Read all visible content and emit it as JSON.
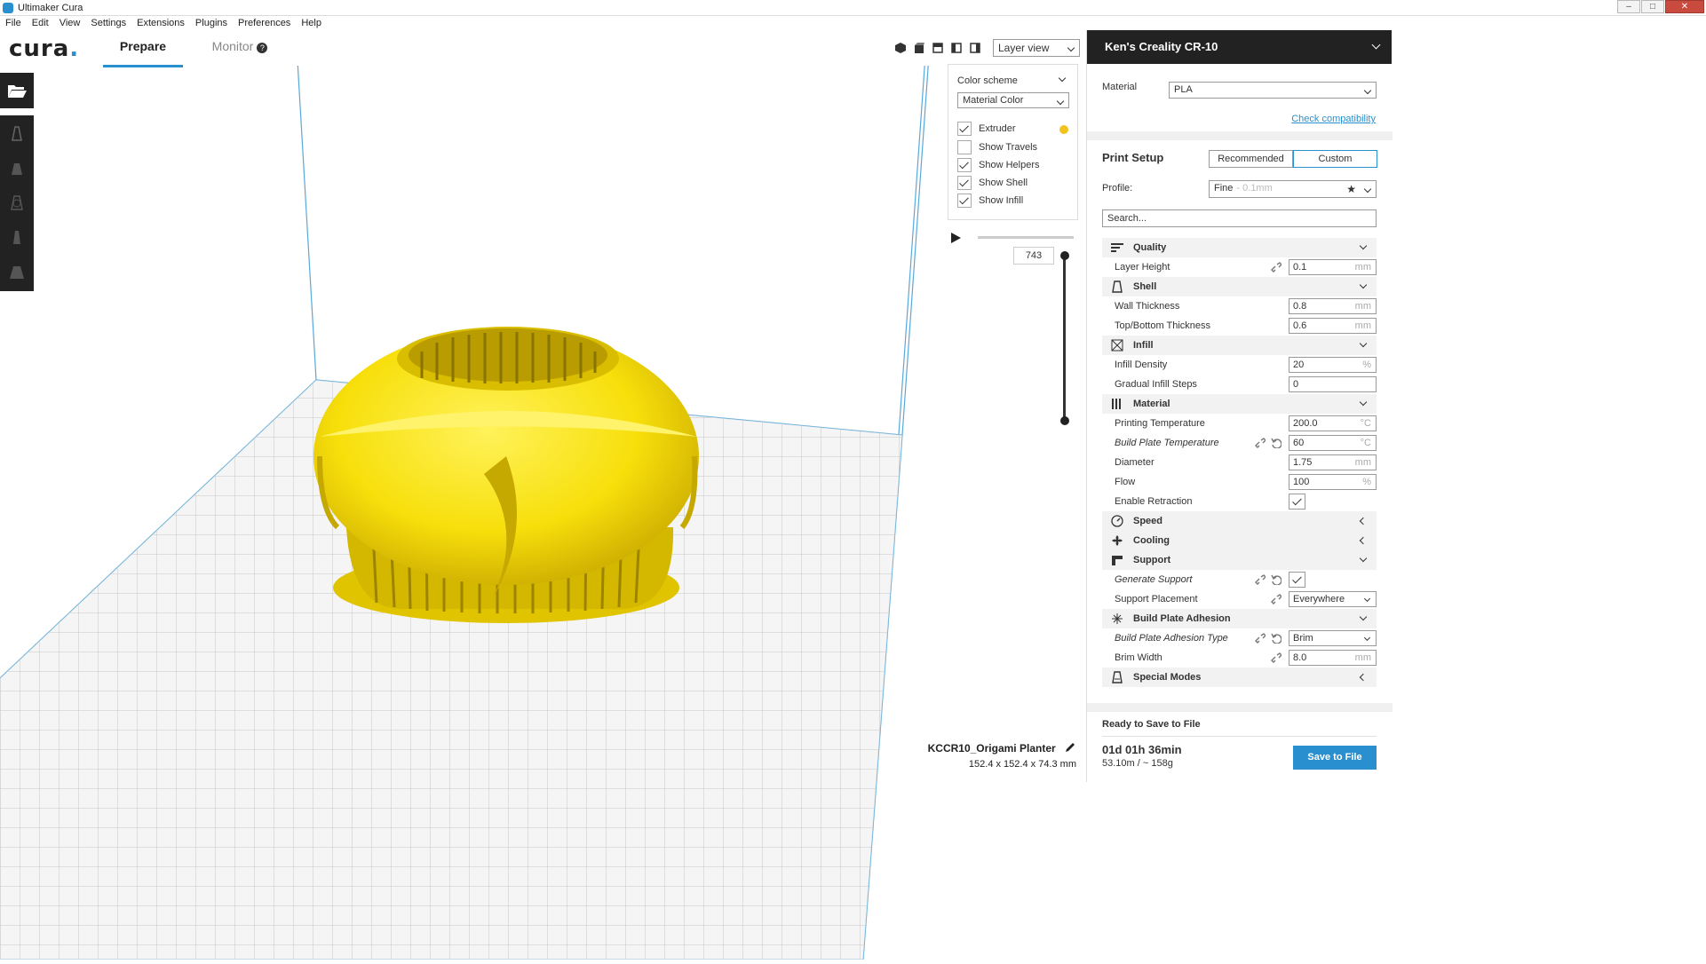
{
  "window": {
    "title": "Ultimaker Cura"
  },
  "menu": [
    "File",
    "Edit",
    "View",
    "Settings",
    "Extensions",
    "Plugins",
    "Preferences",
    "Help"
  ],
  "header": {
    "logo": "cura",
    "tabs": [
      {
        "label": "Prepare",
        "active": true
      },
      {
        "label": "Monitor"
      }
    ]
  },
  "view": {
    "mode": "Layer view"
  },
  "layer_panel": {
    "color_scheme_label": "Color scheme",
    "color_scheme": "Material Color",
    "options": [
      {
        "label": "Extruder",
        "checked": true
      },
      {
        "label": "Show Travels",
        "checked": false
      },
      {
        "label": "Show Helpers",
        "checked": true
      },
      {
        "label": "Show Shell",
        "checked": true
      },
      {
        "label": "Show Infill",
        "checked": true
      }
    ],
    "extruder_color": "#f2c31b",
    "current_layer": "743"
  },
  "job": {
    "name": "KCCR10_Origami Planter",
    "dimensions": "152.4 x 152.4 x 74.3 mm"
  },
  "sidebar": {
    "printer": "Ken's Creality CR-10",
    "material_label": "Material",
    "material": "PLA",
    "check_compat": "Check compatibility",
    "print_setup_label": "Print Setup",
    "modes": [
      "Recommended",
      "Custom"
    ],
    "profile_label": "Profile:",
    "profile": "Fine",
    "profile_sub": "0.1mm",
    "search_placeholder": "Search...",
    "categories": {
      "quality": "Quality",
      "shell": "Shell",
      "infill": "Infill",
      "material": "Material",
      "speed": "Speed",
      "cooling": "Cooling",
      "support": "Support",
      "adhesion": "Build Plate Adhesion",
      "special": "Special Modes"
    },
    "settings": {
      "layer_height": {
        "label": "Layer Height",
        "value": "0.1",
        "unit": "mm"
      },
      "wall_thickness": {
        "label": "Wall Thickness",
        "value": "0.8",
        "unit": "mm"
      },
      "topbottom": {
        "label": "Top/Bottom Thickness",
        "value": "0.6",
        "unit": "mm"
      },
      "infill_density": {
        "label": "Infill Density",
        "value": "20",
        "unit": "%"
      },
      "gradual_infill": {
        "label": "Gradual Infill Steps",
        "value": "0"
      },
      "print_temp": {
        "label": "Printing Temperature",
        "value": "200.0",
        "unit": "°C"
      },
      "bed_temp": {
        "label": "Build Plate Temperature",
        "value": "60",
        "unit": "°C"
      },
      "diameter": {
        "label": "Diameter",
        "value": "1.75",
        "unit": "mm"
      },
      "flow": {
        "label": "Flow",
        "value": "100",
        "unit": "%"
      },
      "retraction": {
        "label": "Enable Retraction"
      },
      "gen_support": {
        "label": "Generate Support"
      },
      "support_place": {
        "label": "Support Placement",
        "value": "Everywhere"
      },
      "adhesion_type": {
        "label": "Build Plate Adhesion Type",
        "value": "Brim"
      },
      "brim_width": {
        "label": "Brim Width",
        "value": "8.0",
        "unit": "mm"
      }
    },
    "ready_label": "Ready to Save to File",
    "print_time": "01d 01h 36min",
    "material_usage": "53.10m / ~ 158g",
    "save_button": "Save to File"
  },
  "colors": {
    "accent": "#2a8fcf",
    "model": "#f7df0b",
    "dark": "#222222"
  }
}
